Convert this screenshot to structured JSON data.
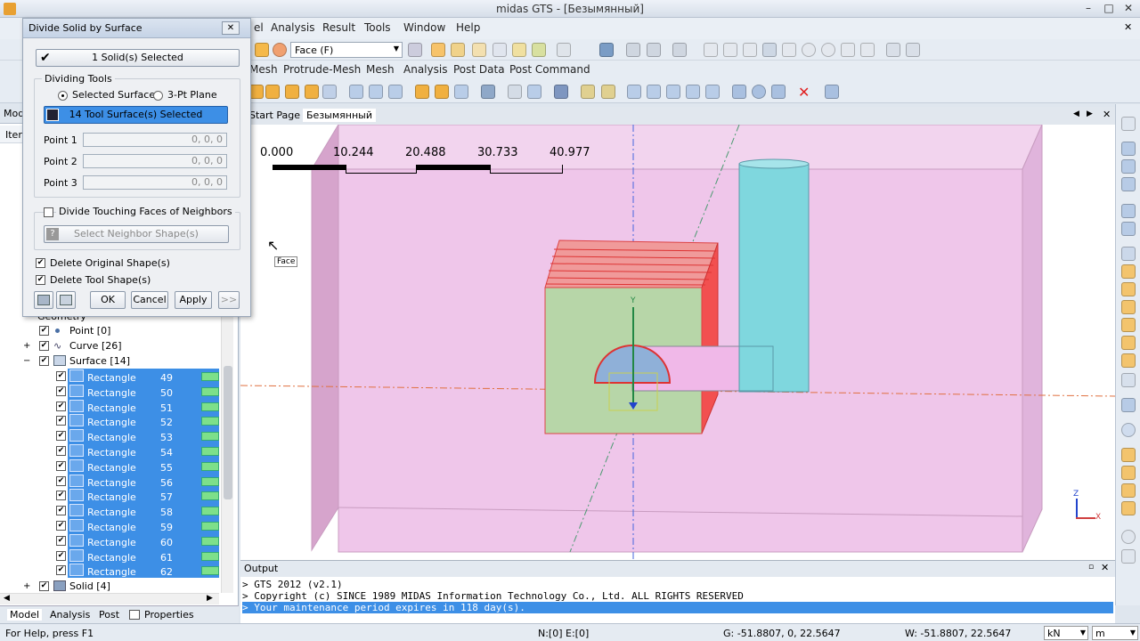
{
  "app": {
    "title": "midas GTS - [Безымянный]"
  },
  "menu": [
    "el",
    "Analysis",
    "Result",
    "Tools",
    "Window",
    "Help"
  ],
  "toolbar": {
    "face_select": "Face (F)"
  },
  "ribbon_tabs": [
    "Mesh",
    "Protrude-Mesh",
    "Mesh",
    "Analysis",
    "Post Data",
    "Post Command"
  ],
  "doc_tabs": [
    "Start Page",
    "Безымянный"
  ],
  "left_panel": {
    "tab_label": "Mod",
    "side_label": "Iter",
    "tree": {
      "geometry_label": "Geometry",
      "point": "Point [0]",
      "curve": "Curve [26]",
      "surface": "Surface [14]",
      "solid": "Solid [4]",
      "rect_label": "Rectangle",
      "rect_numbers": [
        "49",
        "50",
        "51",
        "52",
        "53",
        "54",
        "55",
        "56",
        "57",
        "58",
        "59",
        "60",
        "61",
        "62"
      ]
    }
  },
  "bottom_tabs": [
    "Model",
    "Analysis",
    "Post",
    "Properties"
  ],
  "dialog": {
    "title": "Divide Solid by Surface",
    "solids_selected": "1 Solid(s) Selected",
    "dividing_tools": "Dividing Tools",
    "opt_surface": "Selected Surface",
    "opt_3pt": "3-Pt Plane",
    "tool_surfaces": "14 Tool Surface(s) Selected",
    "point1_label": "Point 1",
    "point2_label": "Point 2",
    "point3_label": "Point 3",
    "point1_val": "0, 0, 0",
    "point2_val": "0, 0, 0",
    "point3_val": "0, 0, 0",
    "touching": "Divide Touching Faces of Neighbors",
    "select_neighbor": "Select Neighbor Shape(s)",
    "delete_original": "Delete Original Shape(s)",
    "delete_tool": "Delete Tool Shape(s)",
    "ok": "OK",
    "cancel": "Cancel",
    "apply": "Apply",
    "more": ">>"
  },
  "viewport": {
    "scale_labels": [
      "0.000",
      "10.244",
      "20.488",
      "30.733",
      "40.977"
    ],
    "cursor_tooltip": "Face",
    "axis_y": "Y",
    "axis_z": "Z",
    "axis_x": "X"
  },
  "output": {
    "title": "Output",
    "lines": [
      "> GTS 2012 (v2.1)",
      "> Copyright (c) SINCE 1989 MIDAS Information Technology Co., Ltd. ALL RIGHTS RESERVED",
      "> Your maintenance period expires in 118 day(s)."
    ]
  },
  "status": {
    "help": "For Help, press F1",
    "ne": "N:[0] E:[0]",
    "g": "G: -51.8807, 0, 22.5647",
    "w": "W: -51.8807, 22.5647",
    "unit_force": "kN",
    "unit_len": "m"
  },
  "colors": {
    "selection": "#3d8fe6",
    "viewport_box": "#efc6ea",
    "solid_green": "#b7d6a8",
    "cylinder": "#7fd7de"
  }
}
